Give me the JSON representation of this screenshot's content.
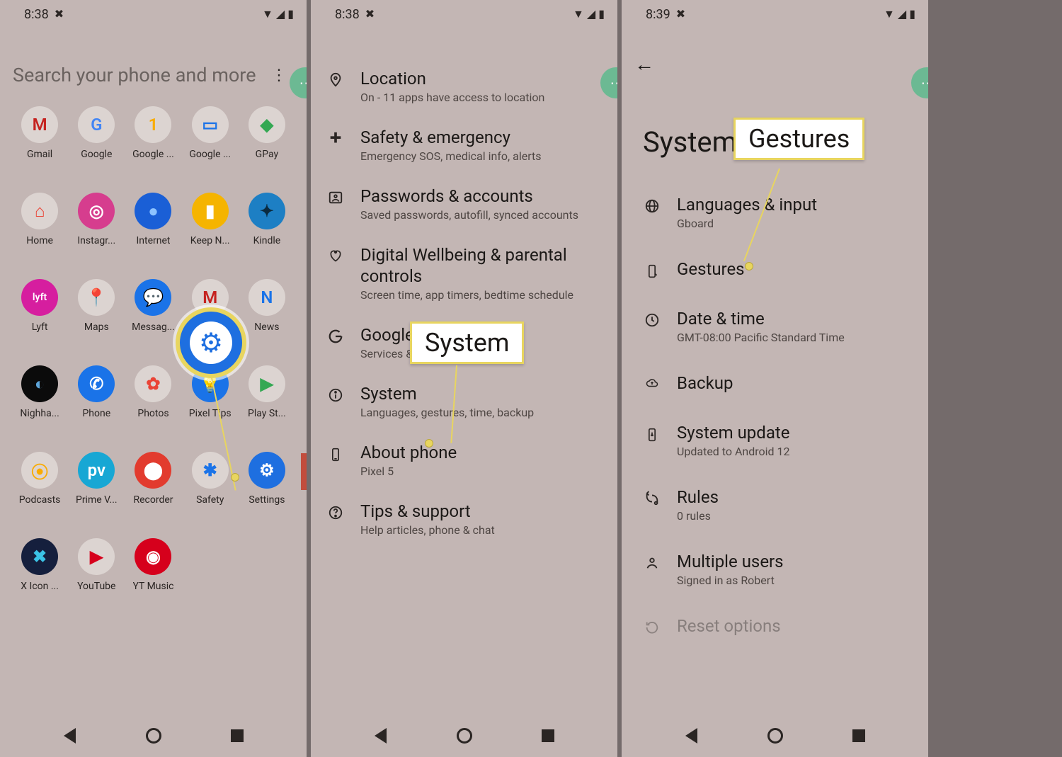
{
  "status": {
    "time1": "8:38",
    "time2": "8:38",
    "time3": "8:39"
  },
  "drawer": {
    "search_placeholder": "Search your phone and more",
    "apps": [
      {
        "label": "Gmail",
        "glyph": "M",
        "bg": "#dcd4d1",
        "fg": "#c5221f"
      },
      {
        "label": "Google",
        "glyph": "G",
        "bg": "#dcd4d1",
        "fg": "#4285f4"
      },
      {
        "label": "Google ...",
        "glyph": "1",
        "bg": "#dcd4d1",
        "fg": "#f9ab00"
      },
      {
        "label": "Google ...",
        "glyph": "▭",
        "bg": "#dcd4d1",
        "fg": "#1a73e8"
      },
      {
        "label": "GPay",
        "glyph": "◆",
        "bg": "#dcd4d1",
        "fg": "#34a853"
      },
      {
        "label": "Home",
        "glyph": "⌂",
        "bg": "#dcd4d1",
        "fg": "#ea4335"
      },
      {
        "label": "Instagr...",
        "glyph": "◎",
        "bg": "#d63d8e",
        "fg": "#fff"
      },
      {
        "label": "Internet",
        "glyph": "●",
        "bg": "#1a5fd6",
        "fg": "#8dc3ff"
      },
      {
        "label": "Keep N...",
        "glyph": "▮",
        "bg": "#f5b400",
        "fg": "#fff"
      },
      {
        "label": "Kindle",
        "glyph": "✦",
        "bg": "#1d7fc4",
        "fg": "#0b2b40"
      },
      {
        "label": "Lyft",
        "glyph": "lyft",
        "bg": "#d61e9f",
        "fg": "#fff"
      },
      {
        "label": "Maps",
        "glyph": "📍",
        "bg": "#dcd4d1",
        "fg": "#34a853"
      },
      {
        "label": "Messag...",
        "glyph": "💬",
        "bg": "#1a73e8",
        "fg": "#fff"
      },
      {
        "label": "Gmail",
        "glyph": "M",
        "bg": "#dcd4d1",
        "fg": "#c5221f"
      },
      {
        "label": "News",
        "glyph": "N",
        "bg": "#dcd4d1",
        "fg": "#1a73e8"
      },
      {
        "label": "Nighha...",
        "glyph": "◐",
        "bg": "#0b0b0b",
        "fg": "#5ea5d9"
      },
      {
        "label": "Phone",
        "glyph": "✆",
        "bg": "#1a73e8",
        "fg": "#fff"
      },
      {
        "label": "Photos",
        "glyph": "✿",
        "bg": "#dcd4d1",
        "fg": "#ea4335"
      },
      {
        "label": "Pixel Tips",
        "glyph": "💡",
        "bg": "#1a73e8",
        "fg": "#fff"
      },
      {
        "label": "Play St...",
        "glyph": "▶",
        "bg": "#dcd4d1",
        "fg": "#34a853"
      },
      {
        "label": "Podcasts",
        "glyph": "⦿",
        "bg": "#dcd4d1",
        "fg": "#f9ab00"
      },
      {
        "label": "Prime V...",
        "glyph": "pv",
        "bg": "#17a7d4",
        "fg": "#fff"
      },
      {
        "label": "Recorder",
        "glyph": "⬤",
        "bg": "#e23b2e",
        "fg": "#fff"
      },
      {
        "label": "Safety",
        "glyph": "✱",
        "bg": "#dcd4d1",
        "fg": "#1a73e8"
      },
      {
        "label": "Settings",
        "glyph": "⚙",
        "bg": "#1e6fe0",
        "fg": "#fff"
      },
      {
        "label": "X Icon ...",
        "glyph": "✖",
        "bg": "#151f3d",
        "fg": "#3bc3e6"
      },
      {
        "label": "YouTube",
        "glyph": "▶",
        "bg": "#dcd4d1",
        "fg": "#d6001c"
      },
      {
        "label": "YT Music",
        "glyph": "◉",
        "bg": "#d6001c",
        "fg": "#fff"
      }
    ]
  },
  "settings_list": [
    {
      "icon": "location",
      "title": "Location",
      "sub": "On - 11 apps have access to location"
    },
    {
      "icon": "medical",
      "title": "Safety & emergency",
      "sub": "Emergency SOS, medical info, alerts"
    },
    {
      "icon": "account",
      "title": "Passwords & accounts",
      "sub": "Saved passwords, autofill, synced accounts"
    },
    {
      "icon": "wellbeing",
      "title": "Digital Wellbeing & parental controls",
      "sub": "Screen time, app timers, bedtime schedule"
    },
    {
      "icon": "google",
      "title": "Google",
      "sub": "Services & preferences"
    },
    {
      "icon": "info",
      "title": "System",
      "sub": "Languages, gestures, time, backup"
    },
    {
      "icon": "phone",
      "title": "About phone",
      "sub": "Pixel 5"
    },
    {
      "icon": "help",
      "title": "Tips & support",
      "sub": "Help articles, phone & chat"
    }
  ],
  "system_page": {
    "header": "System",
    "items": [
      {
        "icon": "globe",
        "title": "Languages & input",
        "sub": "Gboard"
      },
      {
        "icon": "gesture",
        "title": "Gestures",
        "sub": ""
      },
      {
        "icon": "clock",
        "title": "Date & time",
        "sub": "GMT-08:00 Pacific Standard Time"
      },
      {
        "icon": "cloud",
        "title": "Backup",
        "sub": ""
      },
      {
        "icon": "update",
        "title": "System update",
        "sub": "Updated to Android 12"
      },
      {
        "icon": "rules",
        "title": "Rules",
        "sub": "0 rules"
      },
      {
        "icon": "person",
        "title": "Multiple users",
        "sub": "Signed in as Robert"
      },
      {
        "icon": "reset",
        "title": "Reset options",
        "sub": ""
      }
    ]
  },
  "callouts": {
    "p2_label": "System",
    "p3_label": "Gestures"
  }
}
